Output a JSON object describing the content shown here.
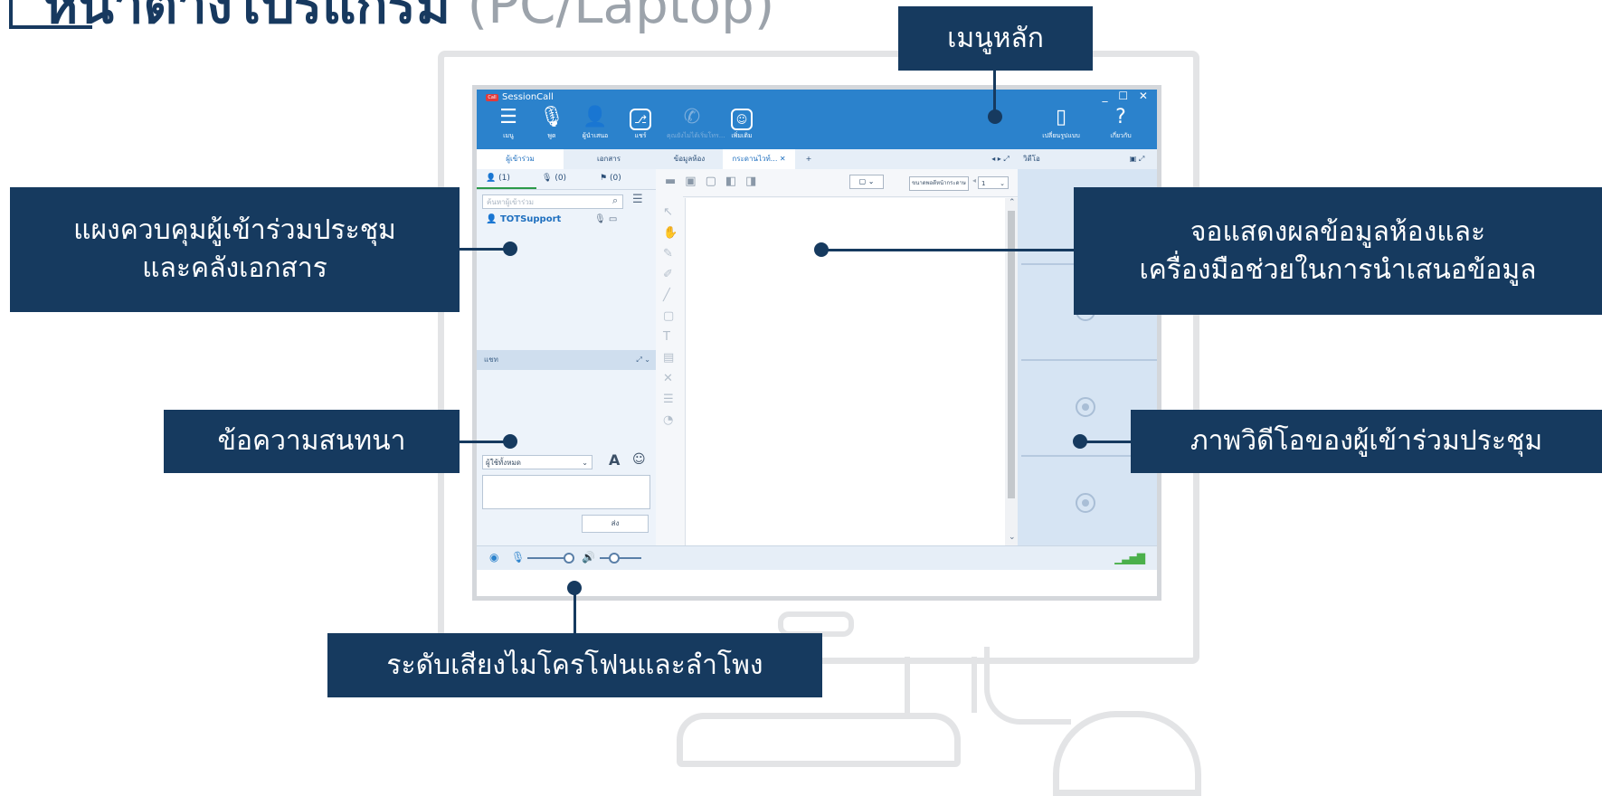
{
  "page": {
    "title_bold": "หน้าต่างโปรแกรม",
    "title_light": "(PC/Laptop)"
  },
  "window": {
    "app_title": "SessionCall",
    "app_logo_text": "Call",
    "controls": "_ ☐ ✕",
    "toolbar": [
      {
        "icon": "menu-icon",
        "glyph": "☰",
        "label": "เมนู"
      },
      {
        "icon": "microphone-icon",
        "glyph": "🎙",
        "label": "พูด"
      },
      {
        "icon": "presenter-icon",
        "glyph": "👤",
        "label": "ผู้นำเสนอ"
      },
      {
        "icon": "share-icon",
        "glyph": "⎇",
        "label": "แชร์"
      },
      {
        "icon": "phone-icon",
        "glyph": "✆",
        "label": "คุณยังไม่ได้เริ่มโทร..."
      },
      {
        "icon": "more-icon",
        "glyph": "☺",
        "label": "เพิ่มเติม"
      }
    ],
    "toolbar_right": [
      {
        "icon": "layout-icon",
        "glyph": "▯",
        "label": "เปลี่ยนรูปแบบ"
      },
      {
        "icon": "help-icon",
        "glyph": "?",
        "label": "เกี่ยวกับ"
      }
    ],
    "left_tabs": [
      "ผู้เข้าร่วม",
      "เอกสาร"
    ],
    "participant_counts": [
      "(1)",
      "(0)",
      "(0)"
    ],
    "search_placeholder": "ค้นหาผู้เข้าร่วม",
    "member_name": "TOTSupport",
    "chat_header": "แชท",
    "chat_recipient": "ผู้ใช้ทั้งหมด",
    "chat_send": "ส่ง",
    "doc_tabs": [
      "ข้อมูลห้อง",
      "กระดานไวท์..."
    ],
    "add_tab": "+",
    "zoom_label": "ขนาดพอดีหน้ากระดาษ",
    "page_number": "1",
    "video_panel_title": "วิดีโอ"
  },
  "callouts": {
    "main_menu": "เมนูหลัก",
    "participant_panel_line1": "แผงควบคุมผู้เข้าร่วมประชุม",
    "participant_panel_line2": "และคลังเอกสาร",
    "display_line1": "จอแสดงผลข้อมูลห้องและ",
    "display_line2": "เครื่องมือช่วยในการนำเสนอข้อมูล",
    "chat": "ข้อความสนทนา",
    "video": "ภาพวิดีโอของผู้เข้าร่วมประชุม",
    "volume": "ระดับเสียงไมโครโฟนและลำโพง"
  },
  "colors": {
    "callout_bg": "#163a5f",
    "toolbar_bg": "#2b82cc",
    "panel_bg": "#edf3fa"
  }
}
